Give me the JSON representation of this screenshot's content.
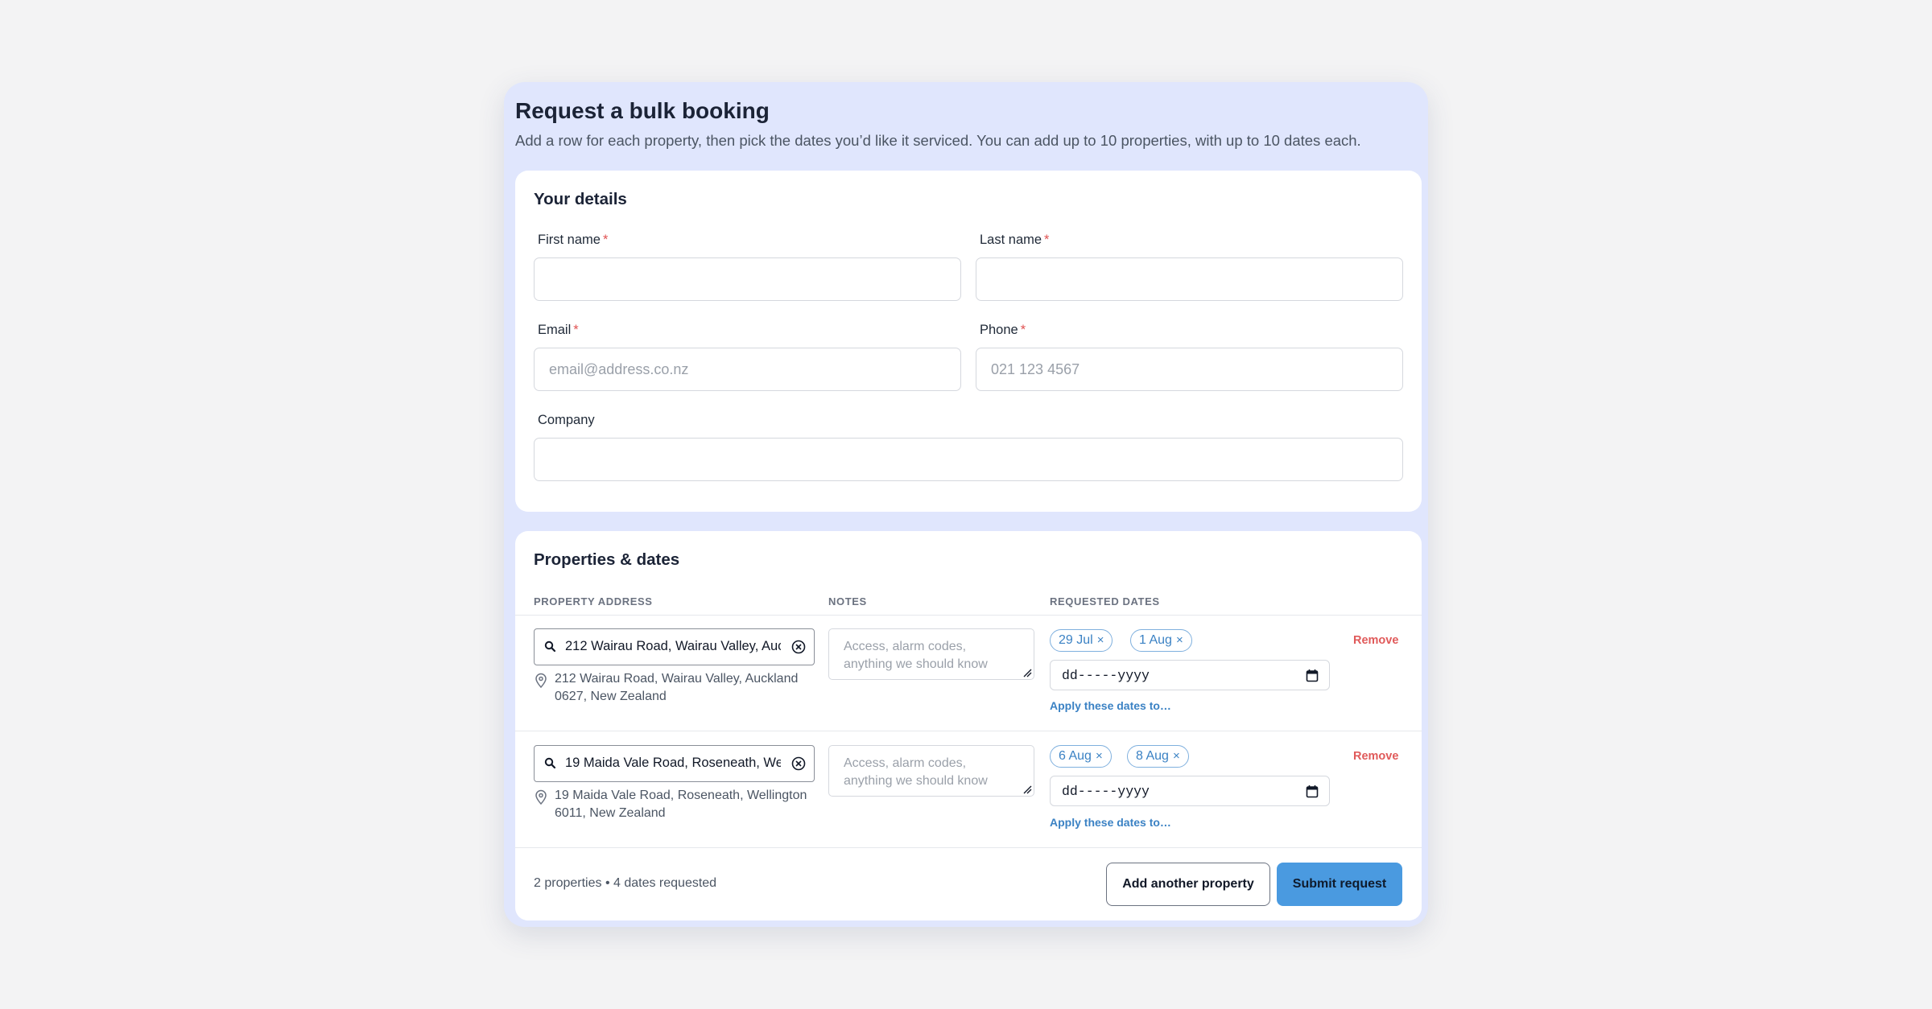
{
  "header": {
    "title": "Request a bulk booking",
    "subtitle": "Add a row for each property, then pick the dates you’d like it serviced. You can add up to 10 properties, with up to 10 dates each."
  },
  "details": {
    "heading": "Your details",
    "required_marker": "*",
    "first_name": {
      "label": "First name",
      "value": "",
      "placeholder": ""
    },
    "last_name": {
      "label": "Last name",
      "value": "",
      "placeholder": ""
    },
    "email": {
      "label": "Email",
      "value": "",
      "placeholder": "email@address.co.nz"
    },
    "phone": {
      "label": "Phone",
      "value": "",
      "placeholder": "021 123 4567"
    },
    "company": {
      "label": "Company",
      "value": "",
      "placeholder": ""
    }
  },
  "properties": {
    "heading": "Properties & dates",
    "columns": {
      "address": "PROPERTY ADDRESS",
      "notes": "NOTES",
      "dates": "REQUESTED DATES"
    },
    "notes_placeholder_line1": "Access, alarm codes,",
    "notes_placeholder_line2": "anything we should know",
    "date_placeholder": "dd-----yyyy",
    "apply_label": "Apply these dates to…",
    "remove_label": "Remove",
    "chip_remove_glyph": "×",
    "rows": [
      {
        "search_value": "212 Wairau Road, Wairau Valley, Auckland 0627, New Zealand",
        "resolved_line1": "212 Wairau Road, Wairau Valley, Auckland",
        "resolved_line2": "0627, New Zealand",
        "dates": [
          "29 Jul",
          "1 Aug"
        ]
      },
      {
        "search_value": "19 Maida Vale Road, Roseneath, Wellington 6011, New Zealand",
        "resolved_line1": "19 Maida Vale Road, Roseneath, Wellington",
        "resolved_line2": "6011, New Zealand",
        "dates": [
          "6 Aug",
          "8 Aug"
        ]
      }
    ]
  },
  "footer": {
    "summary": "2 properties • 4 dates requested",
    "add_label": "Add another property",
    "submit_label": "Submit request"
  },
  "colors": {
    "accent": "#4a9ae0",
    "link": "#3b82c4",
    "danger": "#e05a5a",
    "card_bg": "#e0e6fd"
  },
  "icons": {
    "search": "search-icon",
    "clear": "clear-icon",
    "pin": "map-pin-icon",
    "calendar": "calendar-icon",
    "resize": "resize-grip-icon"
  }
}
